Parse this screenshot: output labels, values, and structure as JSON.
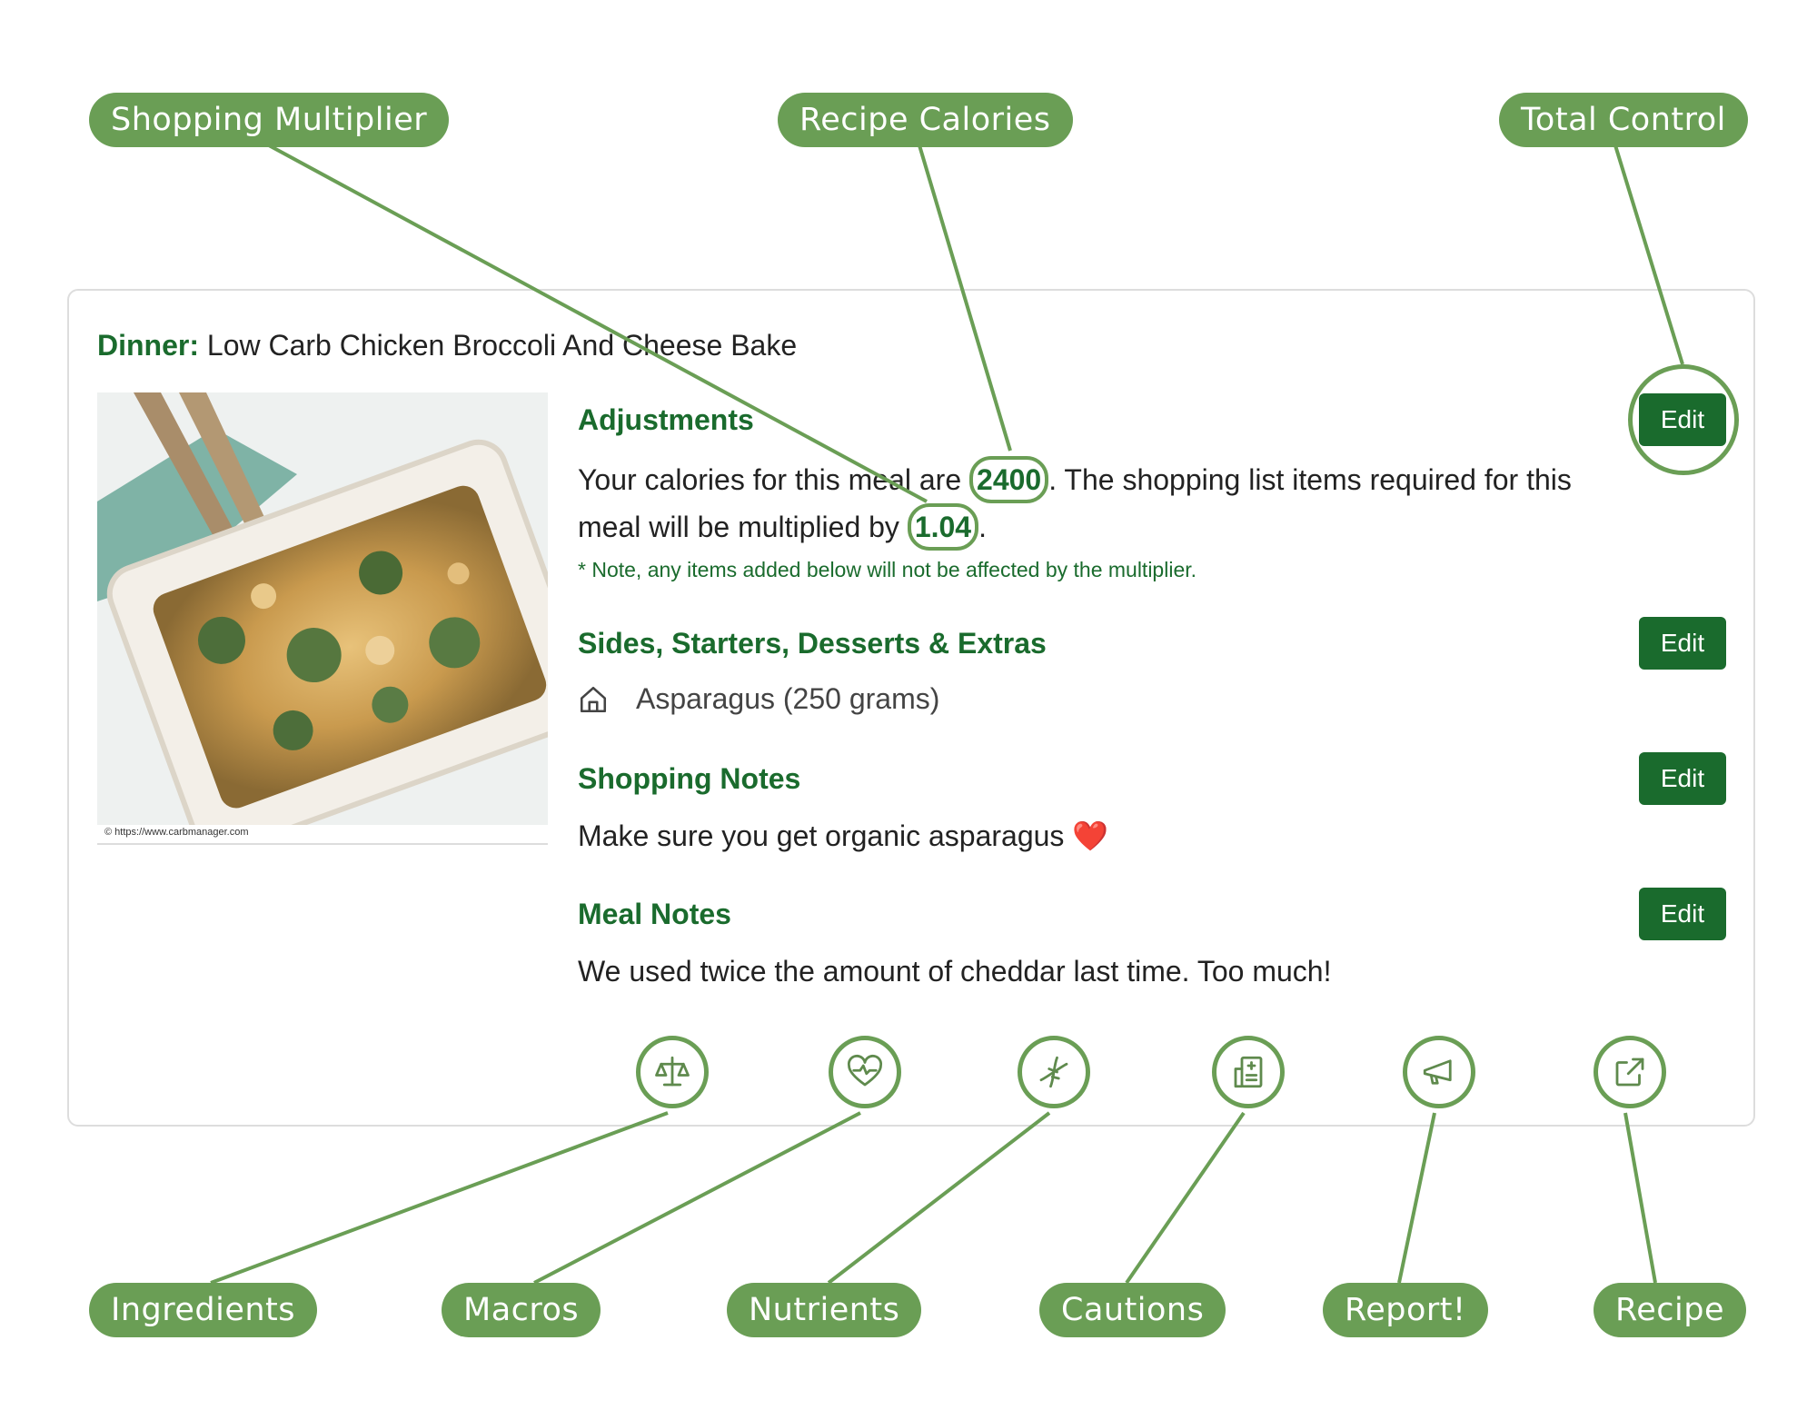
{
  "callouts": {
    "shopping_multiplier": "Shopping Multiplier",
    "recipe_calories": "Recipe Calories",
    "total_control": "Total Control",
    "ingredients": "Ingredients",
    "macros": "Macros",
    "nutrients": "Nutrients",
    "cautions": "Cautions",
    "report": "Report!",
    "recipe": "Recipe"
  },
  "meal": {
    "type_label": "Dinner:",
    "name": "Low Carb Chicken Broccoli And Cheese Bake",
    "photo_credit": "© https://www.carbmanager.com"
  },
  "adjustments": {
    "heading": "Adjustments",
    "text_before_calories": "Your calories for this meal are ",
    "calories": "2400",
    "text_after_calories": ". The shopping list items required for this meal will be multiplied by ",
    "multiplier": "1.04",
    "text_end": ".",
    "note": "* Note, any items added below will not be affected by the multiplier.",
    "edit_label": "Edit"
  },
  "sides": {
    "heading": "Sides, Starters, Desserts & Extras",
    "items": [
      {
        "icon": "home-icon",
        "label": "Asparagus (250 grams)"
      }
    ],
    "edit_label": "Edit"
  },
  "shopping_notes": {
    "heading": "Shopping Notes",
    "text": "Make sure you get organic asparagus",
    "emoji": "❤️",
    "edit_label": "Edit"
  },
  "meal_notes": {
    "heading": "Meal Notes",
    "text": "We used twice the amount of cheddar last time. Too much!",
    "edit_label": "Edit"
  },
  "actions": [
    {
      "name": "ingredients",
      "icon": "scale-icon"
    },
    {
      "name": "macros",
      "icon": "heart-pulse-icon"
    },
    {
      "name": "nutrients",
      "icon": "dna-icon"
    },
    {
      "name": "cautions",
      "icon": "medical-building-icon"
    },
    {
      "name": "report",
      "icon": "megaphone-icon"
    },
    {
      "name": "recipe",
      "icon": "external-link-icon"
    }
  ],
  "colors": {
    "brand_green": "#1a6b2d",
    "callout_green": "#6a9e55",
    "heart_red": "#e0202a"
  }
}
